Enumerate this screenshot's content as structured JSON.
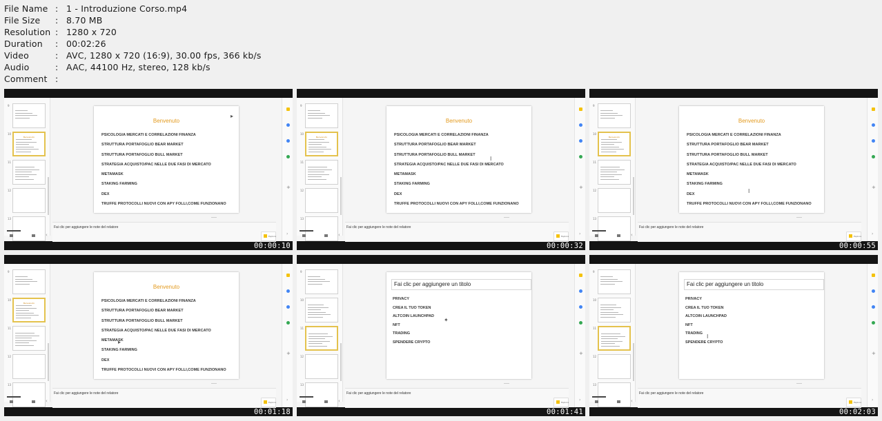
{
  "file_info": [
    {
      "label": "File Name",
      "sep": ":",
      "value": "1 - Introduzione Corso.mp4"
    },
    {
      "label": "File Size",
      "sep": ":",
      "value": "8.70 MB"
    },
    {
      "label": "Resolution",
      "sep": ":",
      "value": "1280 x 720"
    },
    {
      "label": "Duration",
      "sep": ":",
      "value": "00:02:26"
    },
    {
      "label": "Video",
      "sep": ":",
      "value": "AVC, 1280 x 720 (16:9), 30.00 fps, 366 kb/s"
    },
    {
      "label": "Audio",
      "sep": ":",
      "value": "AAC, 44100 Hz, stereo, 128 kb/s"
    },
    {
      "label": "Comment",
      "sep": ":",
      "value": ""
    }
  ],
  "slide_benvenuto": {
    "title": "Benvenuto",
    "items": [
      "PSICOLOGIA MERCATI E CORRELAZIONI FINANZA",
      "STRUTTURA PORTAFOGLIO BEAR MARKET",
      "STRUTTURA PORTAFOGLIO  BULL MARKET",
      "STRATEGIA ACQUISTO/PAC NELLE DUE FASI DI MERCATO",
      "METAMASK",
      "STAKING FARMING",
      "DEX",
      "TRUFFE PROTOCOLLI NUOVI CON APY FOLLI,COME FUNZIONANO"
    ]
  },
  "slide_second": {
    "title": "Fai clic per aggiungere un titolo",
    "items": [
      "PRIVACY",
      "CREA IL TUO TOKEN",
      "ALTCOIN LAUNCHPAD",
      "NFT",
      "TRADING",
      "SPENDERE CRYPTO"
    ]
  },
  "notes_placeholder": "Fai clic per aggiungere le note del relatore",
  "explore_label": "Esplora",
  "thumbnails": [
    {
      "timestamp": "00:00:10",
      "slide": "benvenuto"
    },
    {
      "timestamp": "00:00:32",
      "slide": "benvenuto"
    },
    {
      "timestamp": "00:00:55",
      "slide": "benvenuto"
    },
    {
      "timestamp": "00:01:18",
      "slide": "benvenuto"
    },
    {
      "timestamp": "00:01:41",
      "slide": "second"
    },
    {
      "timestamp": "00:02:03",
      "slide": "second"
    }
  ],
  "colors": {
    "accent": "#e39a1e",
    "selection": "#e4c24d"
  }
}
